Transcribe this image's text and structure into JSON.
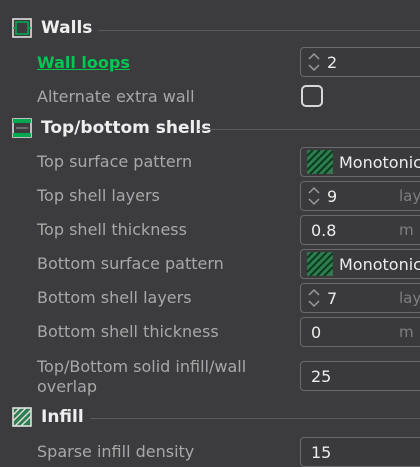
{
  "sections": {
    "walls": {
      "title": "Walls"
    },
    "shells": {
      "title": "Top/bottom shells"
    },
    "infill": {
      "title": "Infill"
    }
  },
  "settings": {
    "wall_loops": {
      "label": "Wall loops",
      "value": "2"
    },
    "alternate_extra_wall": {
      "label": "Alternate extra wall",
      "checked": false
    },
    "top_surface_pattern": {
      "label": "Top surface pattern",
      "value": "Monotonic"
    },
    "top_shell_layers": {
      "label": "Top shell layers",
      "value": "9",
      "unit": "lay"
    },
    "top_shell_thickness": {
      "label": "Top shell thickness",
      "value": "0.8",
      "unit": "m"
    },
    "bottom_surface_pattern": {
      "label": "Bottom surface pattern",
      "value": "Monotonic"
    },
    "bottom_shell_layers": {
      "label": "Bottom shell layers",
      "value": "7",
      "unit": "lay"
    },
    "bottom_shell_thickness": {
      "label": "Bottom shell thickness",
      "value": "0",
      "unit": "m"
    },
    "solid_infill_overlap": {
      "label_line1": "Top/Bottom solid infill/wall",
      "label_line2": "overlap",
      "value": "25"
    },
    "sparse_infill_density": {
      "label": "Sparse infill density",
      "value": "15"
    }
  },
  "colors": {
    "accent": "#00c853",
    "background": "#3c3c3f"
  }
}
